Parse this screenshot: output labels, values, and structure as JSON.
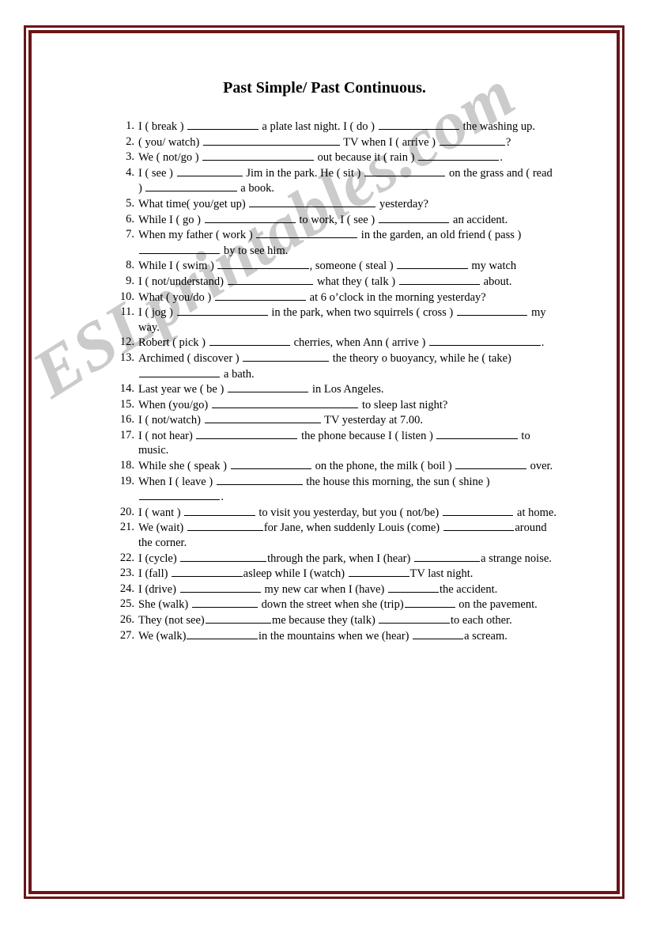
{
  "document": {
    "title": "Past Simple/ Past Continuous.",
    "watermark": "ESLprintables.com",
    "frame_color": "#6B1516",
    "watermark_color": "#c9c9c9",
    "text_color": "#000000",
    "page_background": "#ffffff"
  },
  "exercises": [
    {
      "number": "1.",
      "text": "I ( break ) ______________ a plate last night. I ( do ) ________________ the washing up."
    },
    {
      "number": "2.",
      "text": "( you/ watch) ___________________________ TV when I ( arrive ) _____________?"
    },
    {
      "number": "3.",
      "text": "We ( not/go ) ______________________ out because it ( rain ) ________________."
    },
    {
      "number": "4.",
      "text": "I ( see ) _____________ Jim in the park. He ( sit ) ________________ on the grass and ( read ) __________________ a book."
    },
    {
      "number": "5.",
      "text": "What time( you/get up) _________________________ yesterday?"
    },
    {
      "number": "6.",
      "text": "While I ( go ) __________________ to work, I ( see ) ______________ an accident."
    },
    {
      "number": "7.",
      "text": "When my father ( work ) ____________________ in the garden, an old friend ( pass ) ________________ by to see him."
    },
    {
      "number": "8.",
      "text": "While I ( swim ) __________________, someone ( steal ) ______________ my watch"
    },
    {
      "number": "9.",
      "text": "I ( not/understand) _________________ what they ( talk ) ________________ about."
    },
    {
      "number": "10.",
      "text": "What ( you/do ) __________________ at 6 o’clock in the morning yesterday?"
    },
    {
      "number": "11.",
      "text": "I ( jog ) __________________ in the park, when two squirrels ( cross ) ______________ my way."
    },
    {
      "number": "12.",
      "text": "Robert ( pick ) ________________ cherries, when Ann ( arrive ) ______________________."
    },
    {
      "number": "13.",
      "text": "Archimed ( discover ) _________________ the theory o buoyancy, while he ( take) ________________ a bath."
    },
    {
      "number": "14.",
      "text": "Last year we ( be ) ________________ in Los Angeles."
    },
    {
      "number": "15.",
      "text": "When (you/go) _____________________________ to sleep last night?"
    },
    {
      "number": "16.",
      "text": "I ( not/watch) _______________________ TV yesterday at 7.00."
    },
    {
      "number": "17.",
      "text": "I ( not hear) ____________________ the phone because I ( listen ) ________________ to music."
    },
    {
      "number": "18.",
      "text": "While she ( speak ) ________________ on the phone, the milk ( boil ) ______________ over."
    },
    {
      "number": "19.",
      "text": "When I ( leave ) _________________ the house this morning, the sun ( shine ) ________________."
    },
    {
      "number": "20.",
      "text": "I ( want ) ______________ to visit you yesterday, but you ( not/be) ______________ at home."
    },
    {
      "number": "21.",
      "text": "We (wait) _______________for Jane, when suddenly Louis (come) ______________around the corner."
    },
    {
      "number": "22.",
      "text": "I (cycle) _________________through the park, when I (hear) _____________a strange noise."
    },
    {
      "number": "23.",
      "text": "I (fall) ______________asleep while I (watch) ____________TV last night."
    },
    {
      "number": "24.",
      "text": "I  (drive) ________________ my new car when I (have) __________the accident."
    },
    {
      "number": "25.",
      "text": "She (walk) _____________ down the street when she (trip)__________ on the pavement."
    },
    {
      "number": "26.",
      "text": "They  (not see)_____________me because they (talk) ______________to each other."
    },
    {
      "number": "27.",
      "text": "We (walk)______________in the mountains when we (hear) __________a scream."
    }
  ]
}
